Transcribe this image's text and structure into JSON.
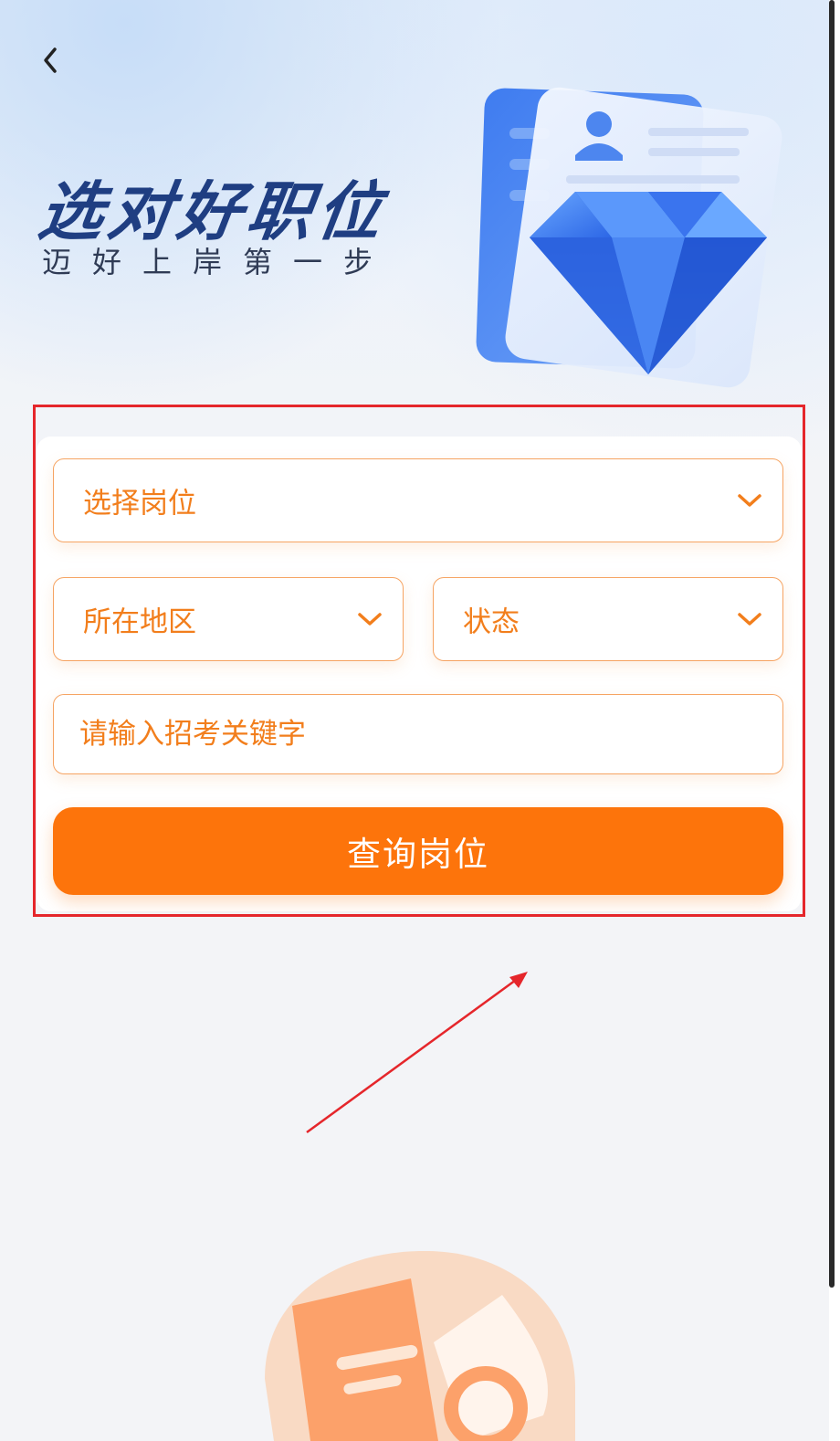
{
  "hero": {
    "title": "选对好职位",
    "subtitle": "迈好上岸第一步"
  },
  "form": {
    "position_select": "选择岗位",
    "region_select": "所在地区",
    "status_select": "状态",
    "keyword_placeholder": "请输入招考关键字",
    "query_button": "查询岗位"
  },
  "colors": {
    "accent": "#fd740b",
    "accent_text": "#f27e1c",
    "title": "#1f3e82",
    "annotation": "#e5262b"
  },
  "icons": {
    "back": "chevron-left-icon",
    "dropdown": "chevron-down-icon"
  }
}
